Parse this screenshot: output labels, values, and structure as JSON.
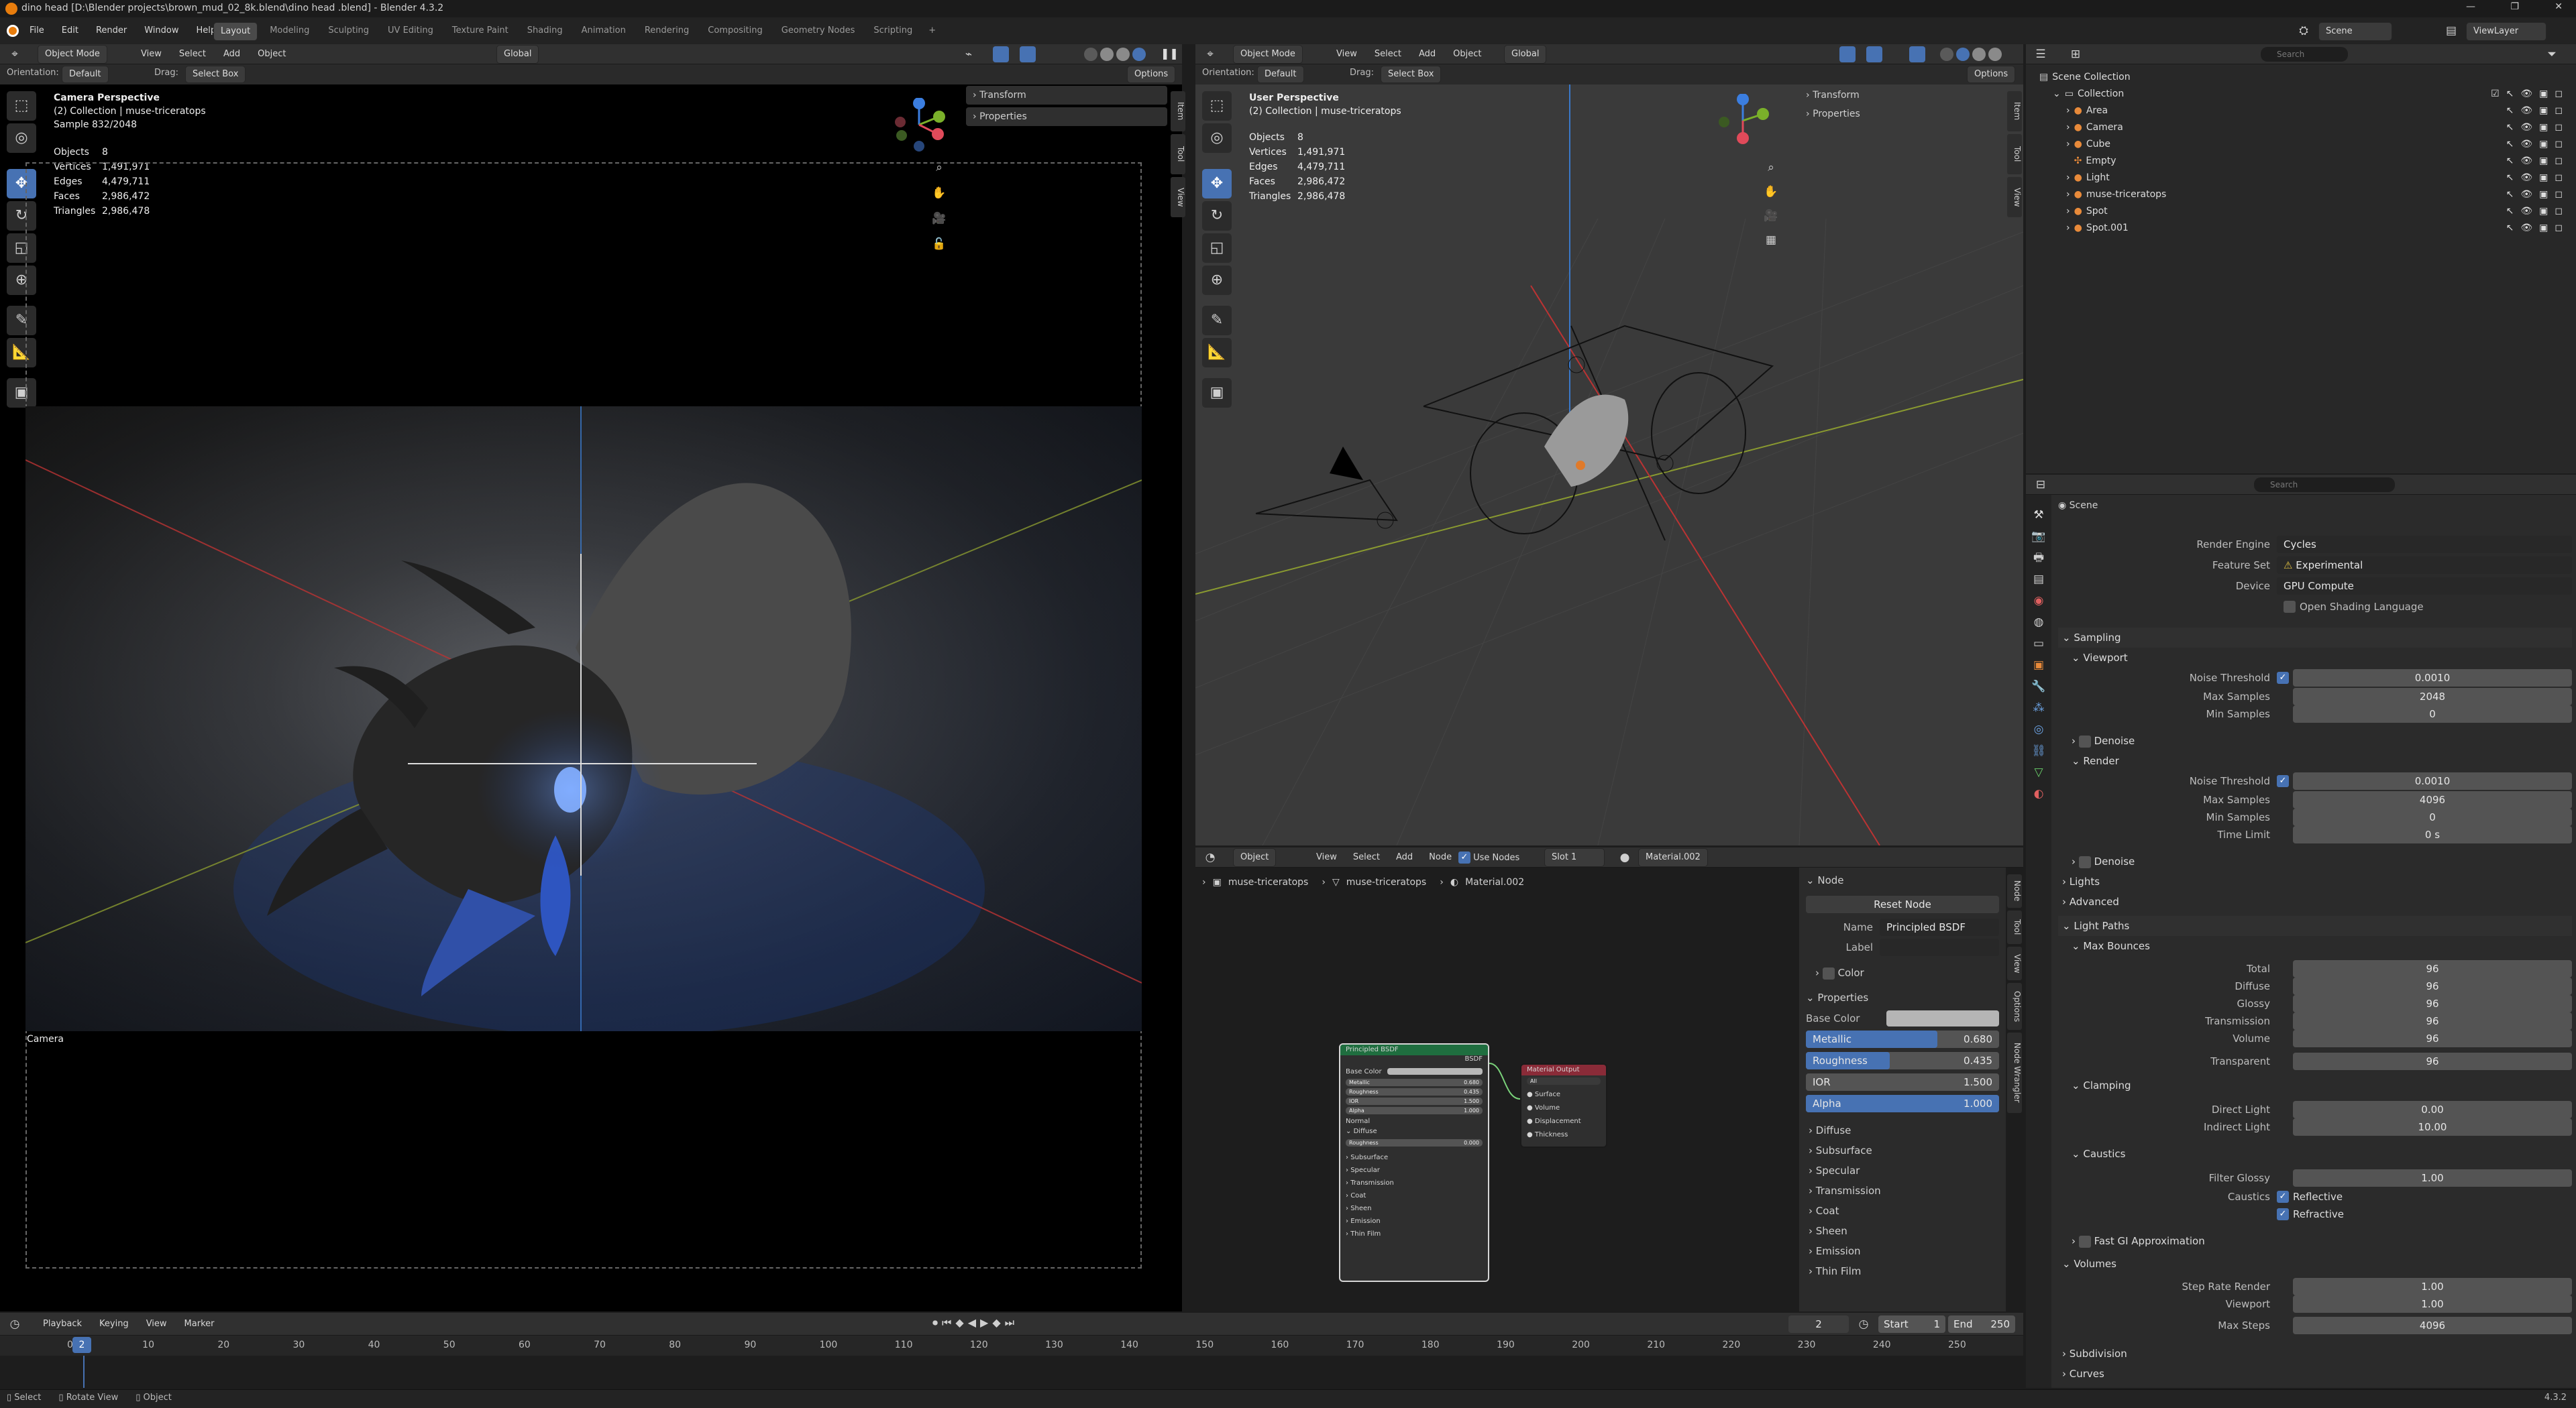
{
  "window": {
    "title": "dino head  [D:\\Blender projects\\brown_mud_02_8k.blend\\dino head .blend] - Blender 4.3.2",
    "controls": [
      "—",
      "❐",
      "✕"
    ]
  },
  "menu": {
    "items": [
      "File",
      "Edit",
      "Render",
      "Window",
      "Help"
    ],
    "workspaces": [
      "Layout",
      "Modeling",
      "Sculpting",
      "UV Editing",
      "Texture Paint",
      "Shading",
      "Animation",
      "Rendering",
      "Compositing",
      "Geometry Nodes",
      "Scripting",
      "+"
    ],
    "active_workspace": "Layout",
    "scene": "Scene",
    "view_layer": "ViewLayer"
  },
  "viewport_left": {
    "mode": "Object Mode",
    "menus": [
      "View",
      "Select",
      "Add",
      "Object"
    ],
    "transform": "Global",
    "orientation_label": "Orientation:",
    "orientation": "Default",
    "drag_label": "Drag:",
    "drag": "Select Box",
    "options": "Options",
    "overlay": {
      "title": "Camera Perspective",
      "collection": "(2) Collection | muse-triceratops",
      "sample": "Sample 832/2048"
    },
    "stats": [
      [
        "Objects",
        "8"
      ],
      [
        "Vertices",
        "1,491,971"
      ],
      [
        "Edges",
        "4,479,711"
      ],
      [
        "Faces",
        "2,986,472"
      ],
      [
        "Triangles",
        "2,986,478"
      ]
    ],
    "npanel": [
      "Transform",
      "Properties"
    ],
    "camera_label": "Camera",
    "side_tabs": [
      "Item",
      "Tool",
      "View"
    ]
  },
  "viewport_right": {
    "mode": "Object Mode",
    "menus": [
      "View",
      "Select",
      "Add",
      "Object"
    ],
    "transform": "Global",
    "orientation_label": "Orientation:",
    "orientation": "Default",
    "drag_label": "Drag:",
    "drag": "Select Box",
    "options": "Options",
    "overlay": {
      "title": "User Perspective",
      "collection": "(2) Collection | muse-triceratops"
    },
    "stats": [
      [
        "Objects",
        "8"
      ],
      [
        "Vertices",
        "1,491,971"
      ],
      [
        "Edges",
        "4,479,711"
      ],
      [
        "Faces",
        "2,986,472"
      ],
      [
        "Triangles",
        "2,986,478"
      ]
    ],
    "npanel": [
      "Transform",
      "Properties"
    ],
    "side_tabs": [
      "Item",
      "Tool",
      "View"
    ]
  },
  "gizmo": {
    "x": "X",
    "y": "Y",
    "z": "Z"
  },
  "outliner": {
    "search_placeholder": "Search",
    "root": "Scene Collection",
    "collection": "Collection",
    "items": [
      {
        "name": "Area",
        "icon": "area-light-icon"
      },
      {
        "name": "Camera",
        "icon": "camera-icon"
      },
      {
        "name": "Cube",
        "icon": "mesh-icon"
      },
      {
        "name": "Empty",
        "icon": "empty-icon"
      },
      {
        "name": "Light",
        "icon": "light-icon"
      },
      {
        "name": "muse-triceratops",
        "icon": "mesh-icon"
      },
      {
        "name": "Spot",
        "icon": "spot-light-icon"
      },
      {
        "name": "Spot.001",
        "icon": "spot-light-icon"
      }
    ]
  },
  "properties": {
    "search_placeholder": "Search",
    "context": "Scene",
    "render_engine_label": "Render Engine",
    "render_engine": "Cycles",
    "feature_set_label": "Feature Set",
    "feature_set": "Experimental",
    "device_label": "Device",
    "device": "GPU Compute",
    "osl": "Open Shading Language",
    "sampling": "Sampling",
    "viewport": "Viewport",
    "noise_threshold": "Noise Threshold",
    "vp_noise": "0.0010",
    "max_samples": "Max Samples",
    "vp_max": "2048",
    "min_samples": "Min Samples",
    "vp_min": "0",
    "denoise": "Denoise",
    "render": "Render",
    "r_noise": "0.0010",
    "r_max": "4096",
    "r_min": "0",
    "time_limit": "Time Limit",
    "r_time": "0 s",
    "lights": "Lights",
    "advanced": "Advanced",
    "light_paths": "Light Paths",
    "max_bounces": "Max Bounces",
    "bounces": [
      [
        "Total",
        "96"
      ],
      [
        "Diffuse",
        "96"
      ],
      [
        "Glossy",
        "96"
      ],
      [
        "Transmission",
        "96"
      ],
      [
        "Volume",
        "96"
      ],
      [
        "Transparent",
        "96"
      ]
    ],
    "clamping": "Clamping",
    "direct_light": "Direct Light",
    "direct_val": "0.00",
    "indirect_light": "Indirect Light",
    "indirect_val": "10.00",
    "caustics": "Caustics",
    "filter_glossy": "Filter Glossy",
    "filter_val": "1.00",
    "caustics_label": "Caustics",
    "reflective": "Reflective",
    "refractive": "Refractive",
    "fast_gi": "Fast GI Approximation",
    "volumes": "Volumes",
    "step_rate_render": "Step Rate Render",
    "step_render_val": "1.00",
    "step_viewport": "Viewport",
    "step_vp_val": "1.00",
    "max_steps": "Max Steps",
    "max_steps_val": "4096",
    "subdivision": "Subdivision",
    "curves": "Curves"
  },
  "shader": {
    "mode": "Object",
    "menus": [
      "View",
      "Select",
      "Add",
      "Node"
    ],
    "use_nodes": "Use Nodes",
    "slot": "Slot 1",
    "material": "Material.002",
    "breadcrumb": [
      "muse-triceratops",
      "muse-triceratops",
      "Material.002"
    ],
    "bsdf": {
      "title": "Principled BSDF",
      "out": "BSDF",
      "rows": [
        [
          "Base Color",
          ""
        ],
        [
          "Metallic",
          "0.680"
        ],
        [
          "Roughness",
          "0.435"
        ],
        [
          "IOR",
          "1.500"
        ],
        [
          "Alpha",
          "1.000"
        ]
      ],
      "normal": "Normal",
      "diffuse": "Diffuse",
      "diff_rough": "Roughness",
      "diff_rough_val": "0.000",
      "sub": [
        "Subsurface",
        "Specular",
        "Transmission",
        "Coat",
        "Sheen",
        "Emission",
        "Thin Film"
      ]
    },
    "output": {
      "title": "Material Output",
      "target": "All",
      "sockets": [
        "Surface",
        "Volume",
        "Displacement",
        "Thickness"
      ]
    },
    "side_tabs": [
      "Node",
      "Tool",
      "View",
      "Options",
      "Node Wrangler"
    ]
  },
  "node_panel": {
    "section": "Node",
    "reset": "Reset Node",
    "name_label": "Name",
    "name": "Principled BSDF",
    "label_label": "Label",
    "label": "",
    "color": "Color",
    "properties": "Properties",
    "base_color": "Base Color",
    "metallic": "Metallic",
    "metallic_val": "0.680",
    "metallic_frac": 0.68,
    "roughness": "Roughness",
    "roughness_val": "0.435",
    "roughness_frac": 0.435,
    "ior": "IOR",
    "ior_val": "1.500",
    "alpha": "Alpha",
    "alpha_val": "1.000",
    "alpha_frac": 1.0,
    "subs": [
      "Diffuse",
      "Subsurface",
      "Specular",
      "Transmission",
      "Coat",
      "Sheen",
      "Emission",
      "Thin Film"
    ]
  },
  "timeline": {
    "menus": [
      "Playback",
      "Keying",
      "View",
      "Marker"
    ],
    "current": "2",
    "start_label": "Start",
    "start": "1",
    "end_label": "End",
    "end": "250",
    "ticks": [
      "0",
      "10",
      "20",
      "30",
      "40",
      "50",
      "60",
      "70",
      "80",
      "90",
      "100",
      "110",
      "120",
      "130",
      "140",
      "150",
      "160",
      "170",
      "180",
      "190",
      "200",
      "210",
      "220",
      "230",
      "240",
      "250"
    ]
  },
  "statusbar": {
    "items": [
      "Select",
      "Rotate View",
      "Object"
    ],
    "version": "4.3.2"
  }
}
